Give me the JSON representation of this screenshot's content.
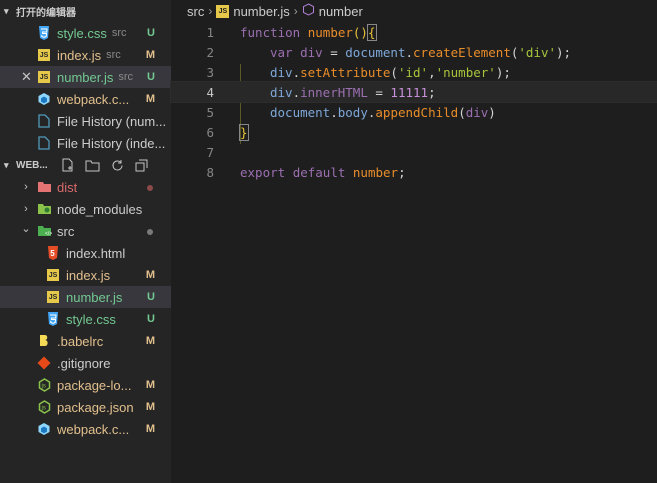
{
  "sidebar": {
    "open_editors_title": "打开的编辑器",
    "open_editors": [
      {
        "name": "style.css",
        "desc": "src",
        "status": "U",
        "icon": "css-icon"
      },
      {
        "name": "index.js",
        "desc": "src",
        "status": "M",
        "icon": "js-icon"
      },
      {
        "name": "number.js",
        "desc": "src",
        "status": "U",
        "icon": "js-icon",
        "selected": true
      },
      {
        "name": "webpack.c...",
        "desc": "",
        "status": "M",
        "icon": "webpack-icon"
      },
      {
        "name": "File History (num...",
        "desc": "",
        "status": "",
        "icon": "file-icon"
      },
      {
        "name": "File History (inde...",
        "desc": "",
        "status": "",
        "icon": "file-icon"
      }
    ],
    "project_title": "WEB...",
    "tree": [
      {
        "name": "dist",
        "type": "folder",
        "expanded": false,
        "dot": "red",
        "name_color": "red"
      },
      {
        "name": "node_modules",
        "type": "folder",
        "expanded": false
      },
      {
        "name": "src",
        "type": "folder",
        "expanded": true,
        "dot": "grey"
      },
      {
        "name": "index.html",
        "type": "html",
        "indent": 1
      },
      {
        "name": "index.js",
        "type": "js",
        "indent": 1,
        "status": "M"
      },
      {
        "name": "number.js",
        "type": "js",
        "indent": 1,
        "status": "U",
        "selected": true
      },
      {
        "name": "style.css",
        "type": "css",
        "indent": 1,
        "status": "U"
      },
      {
        "name": ".babelrc",
        "type": "babel",
        "status": "M"
      },
      {
        "name": ".gitignore",
        "type": "git"
      },
      {
        "name": "package-lo...",
        "type": "node",
        "status": "M"
      },
      {
        "name": "package.json",
        "type": "node",
        "status": "M"
      },
      {
        "name": "webpack.c...",
        "type": "webpack",
        "status": "M"
      }
    ]
  },
  "breadcrumb": {
    "folder": "src",
    "file": "number.js",
    "symbol": "number"
  },
  "code": {
    "line_numbers": [
      "1",
      "2",
      "3",
      "4",
      "5",
      "6",
      "7",
      "8"
    ],
    "l1": {
      "kw": "function",
      "name": "number",
      "paren": "()",
      "brace": "{"
    },
    "l2": {
      "kw": "var",
      "var": "div",
      "eq": " = ",
      "obj": "document",
      "dot": ".",
      "fn": "createElement",
      "open": "(",
      "str": "'div'",
      "close": ");"
    },
    "l3": {
      "obj": "div",
      "dot": ".",
      "fn": "setAttribute",
      "open": "(",
      "s1": "'id'",
      "comma": ",",
      "s2": "'number'",
      "close": ");"
    },
    "l4": {
      "obj": "div",
      "dot": ".",
      "prop": "innerHTML",
      "eq": " = ",
      "num": "11111",
      "end": ";"
    },
    "l5": {
      "obj": "document",
      "dot": ".",
      "prop": "body",
      "dot2": ".",
      "fn": "appendChild",
      "open": "(",
      "arg": "div",
      "close": ")"
    },
    "l6": {
      "brace": "}"
    },
    "l8": {
      "kw1": "export",
      "kw2": "default",
      "name": "number",
      "end": ";"
    }
  }
}
